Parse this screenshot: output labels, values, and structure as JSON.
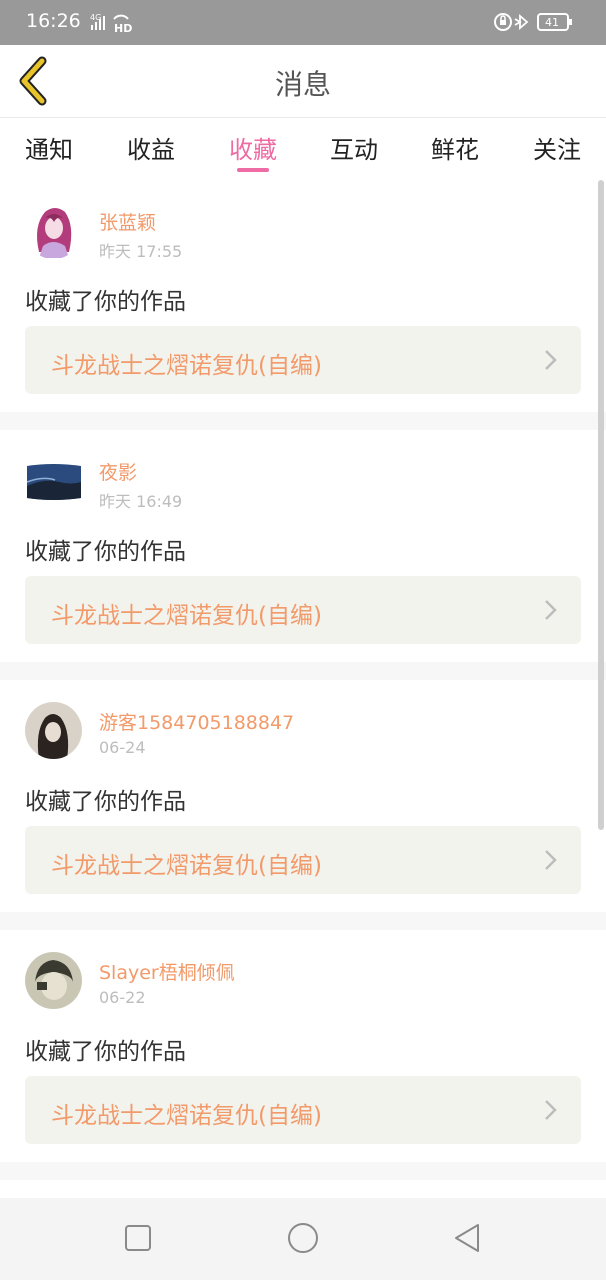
{
  "status_bar": {
    "time": "16:26",
    "network": "4G",
    "hd": "HD",
    "battery": "41"
  },
  "header": {
    "title": "消息"
  },
  "tabs": [
    {
      "label": "通知"
    },
    {
      "label": "收益"
    },
    {
      "label": "收藏"
    },
    {
      "label": "互动"
    },
    {
      "label": "鲜花"
    },
    {
      "label": "关注"
    }
  ],
  "active_tab": "收藏",
  "messages": [
    {
      "username": "张蓝颖",
      "time": "昨天 17:55",
      "action": "收藏了你的作品",
      "work_title": "斗龙战士之熠诺复仇(自编)"
    },
    {
      "username": "夜影",
      "time": "昨天 16:49",
      "action": "收藏了你的作品",
      "work_title": "斗龙战士之熠诺复仇(自编)"
    },
    {
      "username": "游客1584705188847",
      "time": "06-24",
      "action": "收藏了你的作品",
      "work_title": "斗龙战士之熠诺复仇(自编)"
    },
    {
      "username": "Slayer梧桐倾佩",
      "time": "06-22",
      "action": "收藏了你的作品",
      "work_title": "斗龙战士之熠诺复仇(自编)"
    }
  ],
  "colors": {
    "accent": "#ee6ba3",
    "name_orange": "#f29a6a",
    "back_yellow": "#e8c428"
  }
}
